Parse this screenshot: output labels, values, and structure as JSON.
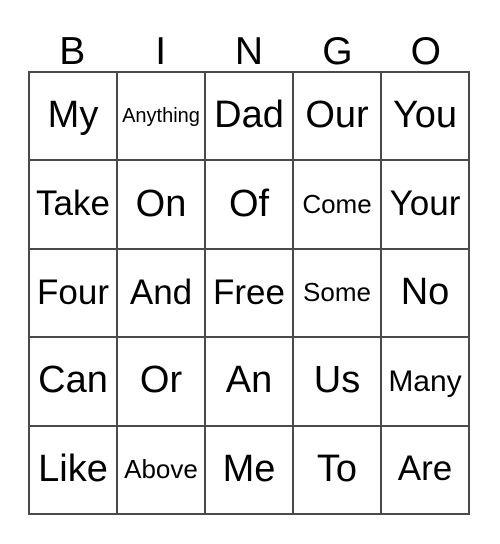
{
  "card": {
    "title": "BINGO",
    "header": {
      "letters": [
        {
          "label": "B"
        },
        {
          "label": "I"
        },
        {
          "label": "N"
        },
        {
          "label": "G"
        },
        {
          "label": "O"
        }
      ]
    },
    "grid": {
      "columns": 5,
      "rows": 5,
      "border_color": "#4a4a4a",
      "background_color": "#ffffff",
      "text_color": "#000000",
      "cells": [
        {
          "text": "My",
          "size": "sz-xl",
          "column": "B",
          "row": 1
        },
        {
          "text": "Anything",
          "size": "sz-xs",
          "column": "I",
          "row": 1
        },
        {
          "text": "Dad",
          "size": "sz-xl",
          "column": "N",
          "row": 1
        },
        {
          "text": "Our",
          "size": "sz-xl",
          "column": "G",
          "row": 1
        },
        {
          "text": "You",
          "size": "sz-xl",
          "column": "O",
          "row": 1
        },
        {
          "text": "Take",
          "size": "sz-lg",
          "column": "B",
          "row": 2
        },
        {
          "text": "On",
          "size": "sz-xl",
          "column": "I",
          "row": 2
        },
        {
          "text": "Of",
          "size": "sz-xl",
          "column": "N",
          "row": 2
        },
        {
          "text": "Come",
          "size": "sz-sm",
          "column": "G",
          "row": 2
        },
        {
          "text": "Your",
          "size": "sz-lg",
          "column": "O",
          "row": 2
        },
        {
          "text": "Four",
          "size": "sz-lg",
          "column": "B",
          "row": 3
        },
        {
          "text": "And",
          "size": "sz-lg",
          "column": "I",
          "row": 3
        },
        {
          "text": "Free",
          "size": "sz-lg",
          "column": "N",
          "row": 3
        },
        {
          "text": "Some",
          "size": "sz-sm",
          "column": "G",
          "row": 3
        },
        {
          "text": "No",
          "size": "sz-xl",
          "column": "O",
          "row": 3
        },
        {
          "text": "Can",
          "size": "sz-xl",
          "column": "B",
          "row": 4
        },
        {
          "text": "Or",
          "size": "sz-xl",
          "column": "I",
          "row": 4
        },
        {
          "text": "An",
          "size": "sz-xl",
          "column": "N",
          "row": 4
        },
        {
          "text": "Us",
          "size": "sz-xl",
          "column": "G",
          "row": 4
        },
        {
          "text": "Many",
          "size": "sz-md",
          "column": "O",
          "row": 4
        },
        {
          "text": "Like",
          "size": "sz-xl",
          "column": "B",
          "row": 5
        },
        {
          "text": "Above",
          "size": "sz-sm",
          "column": "I",
          "row": 5
        },
        {
          "text": "Me",
          "size": "sz-xl",
          "column": "N",
          "row": 5
        },
        {
          "text": "To",
          "size": "sz-xl",
          "column": "G",
          "row": 5
        },
        {
          "text": "Are",
          "size": "sz-lg",
          "column": "O",
          "row": 5
        }
      ]
    }
  }
}
